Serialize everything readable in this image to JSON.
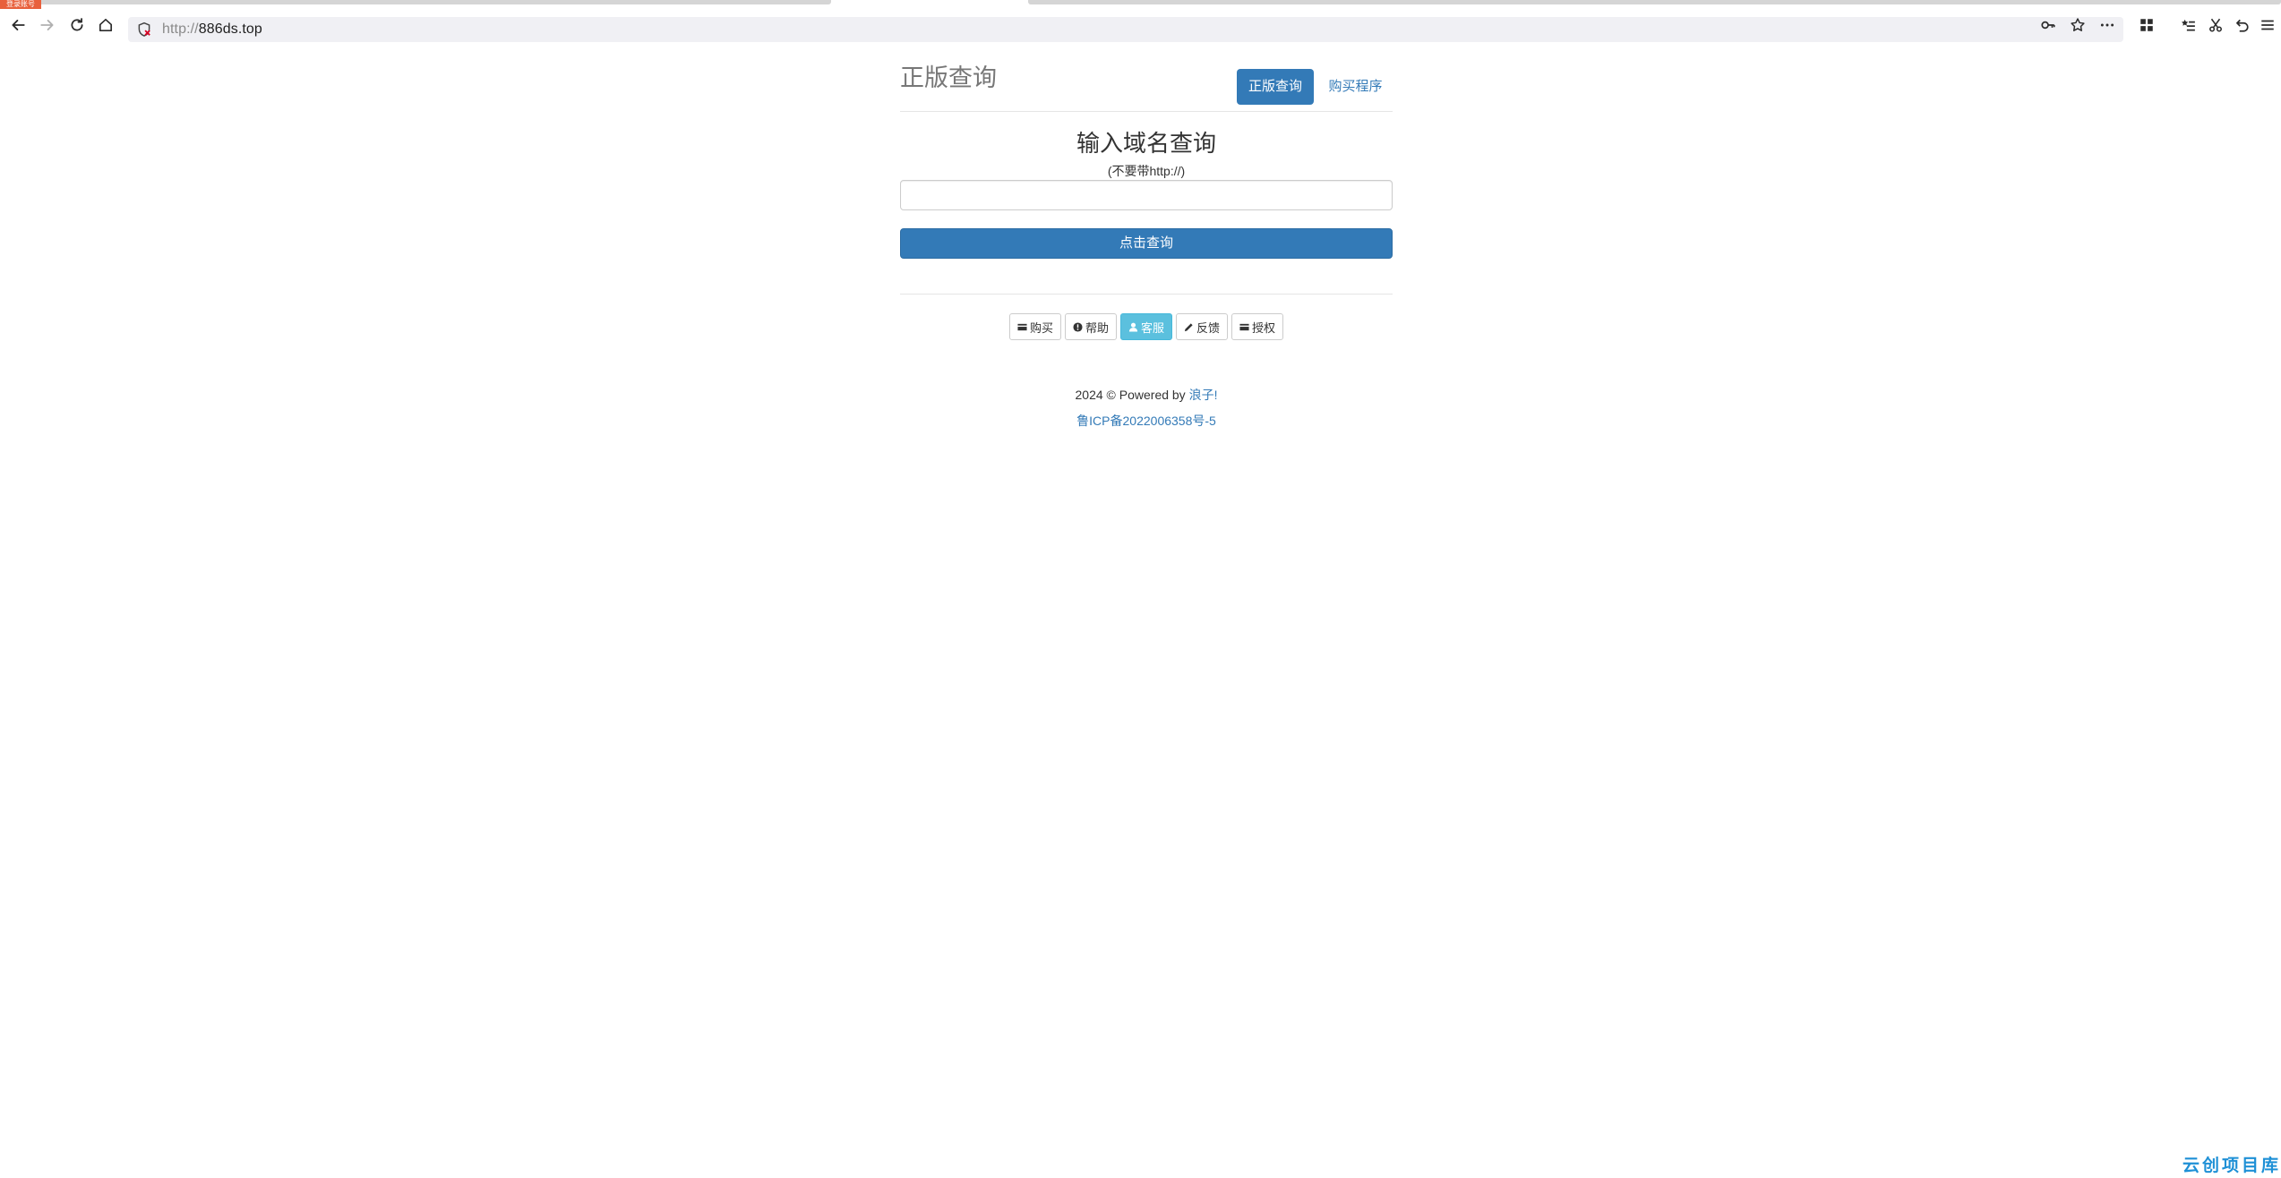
{
  "browser": {
    "corner_badge": "登录账号",
    "url_scheme": "http://",
    "url_host": "886ds.top",
    "icons": [
      "back-icon",
      "forward-icon",
      "reload-icon",
      "home-icon",
      "shield-icon",
      "key-icon",
      "bookmark-star-icon",
      "more-icon",
      "extensions-icon",
      "reading-list-icon",
      "screenshot-icon",
      "undo-icon",
      "menu-icon"
    ]
  },
  "site": {
    "brand": "正版查询",
    "nav_active": "正版查询",
    "nav_buy": "购买程序"
  },
  "query": {
    "title": "输入域名查询",
    "hint": "(不要带http://)",
    "input_value": "",
    "submit_label": "点击查询"
  },
  "actions": {
    "buy": "购买",
    "help": "帮助",
    "service": "客服",
    "feedback": "反馈",
    "license": "授权"
  },
  "footer": {
    "copyright": "2024 © Powered by",
    "author": "浪子!",
    "icp": "鲁ICP备2022006358号-5"
  },
  "watermark": "云创项目库",
  "colors": {
    "primary": "#337ab7",
    "info": "#5bc0de",
    "badge": "#e8603c",
    "watermark": "#1e90d6"
  }
}
